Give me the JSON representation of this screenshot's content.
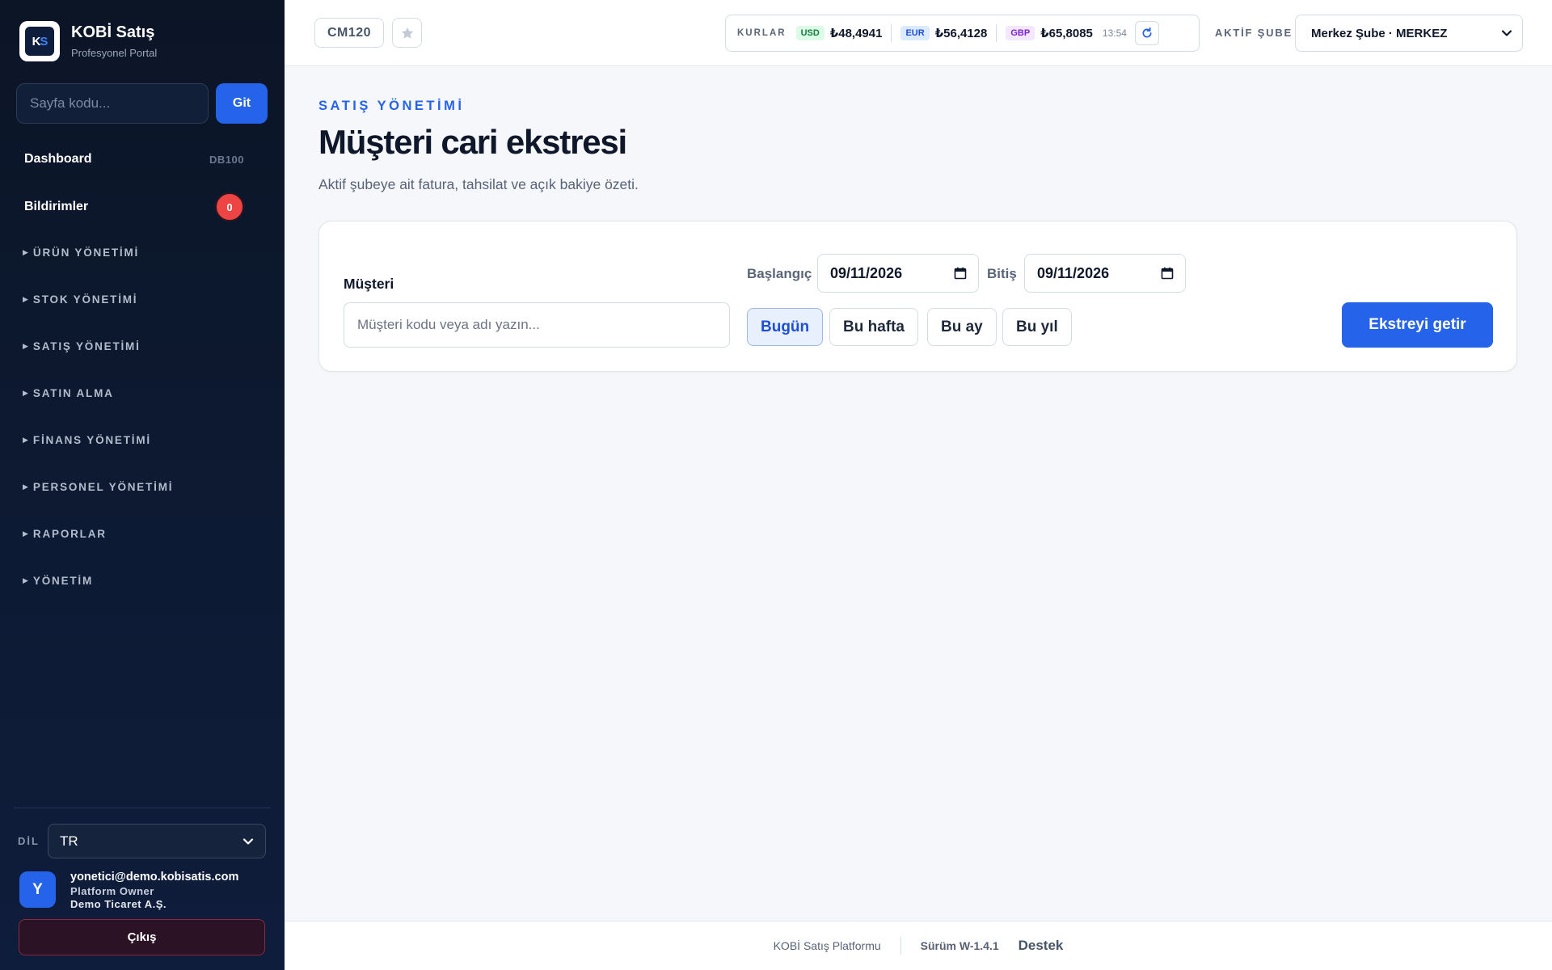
{
  "sidebar": {
    "brand_title": "KOBİ Satış",
    "brand_subtitle": "Profesyonel Portal",
    "goto_placeholder": "Sayfa kodu...",
    "goto_button": "Git",
    "dashboard": {
      "label": "Dashboard",
      "code": "DB100"
    },
    "notifications": {
      "label": "Bildirimler",
      "count": "0"
    },
    "groups": [
      "ÜRÜN YÖNETİMİ",
      "STOK YÖNETİMİ",
      "SATIŞ YÖNETİMİ",
      "SATIN ALMA",
      "FİNANS YÖNETİMİ",
      "PERSONEL YÖNETİMİ",
      "RAPORLAR",
      "YÖNETİM"
    ],
    "language_label": "DİL",
    "language_value": "TR",
    "user": {
      "initial": "Y",
      "email": "yonetici@demo.kobisatis.com",
      "role": "Platform Owner",
      "company": "Demo Ticaret A.Ş."
    },
    "logout_button": "Çıkış"
  },
  "topbar": {
    "page_code": "CM120",
    "rates_label": "KURLAR",
    "rates": [
      {
        "currency": "USD",
        "value": "₺48,4941",
        "tag_bg": "#dcfce7",
        "tag_color": "#15803d"
      },
      {
        "currency": "EUR",
        "value": "₺56,4128",
        "tag_bg": "#dbeafe",
        "tag_color": "#1d4ed8"
      },
      {
        "currency": "GBP",
        "value": "₺65,8085",
        "tag_bg": "#f3e8ff",
        "tag_color": "#7e22ce"
      }
    ],
    "rates_time": "13:54",
    "branch_label": "AKTİF ŞUBE",
    "branch_value": "Merkez Şube · MERKEZ"
  },
  "main": {
    "eyebrow": "SATIŞ YÖNETİMİ",
    "title": "Müşteri cari ekstresi",
    "description": "Aktif şubeye ait fatura, tahsilat ve açık bakiye özeti.",
    "filter": {
      "customer_label": "Müşteri",
      "customer_placeholder": "Müşteri kodu veya adı yazın...",
      "start_label": "Başlangıç",
      "start_value": "09/11/2026",
      "end_label": "Bitiş",
      "end_value": "09/11/2026",
      "quick": [
        "Bugün",
        "Bu hafta",
        "Bu ay",
        "Bu yıl"
      ],
      "submit_button": "Ekstreyi getir"
    }
  },
  "footer": {
    "brand": "KOBİ Satış Platformu",
    "version": "Sürüm W-1.4.1",
    "support": "Destek"
  },
  "colors": {
    "accent": "#2563eb",
    "sidebar_bg": "#0d1a33",
    "badge": "#ef4444"
  }
}
